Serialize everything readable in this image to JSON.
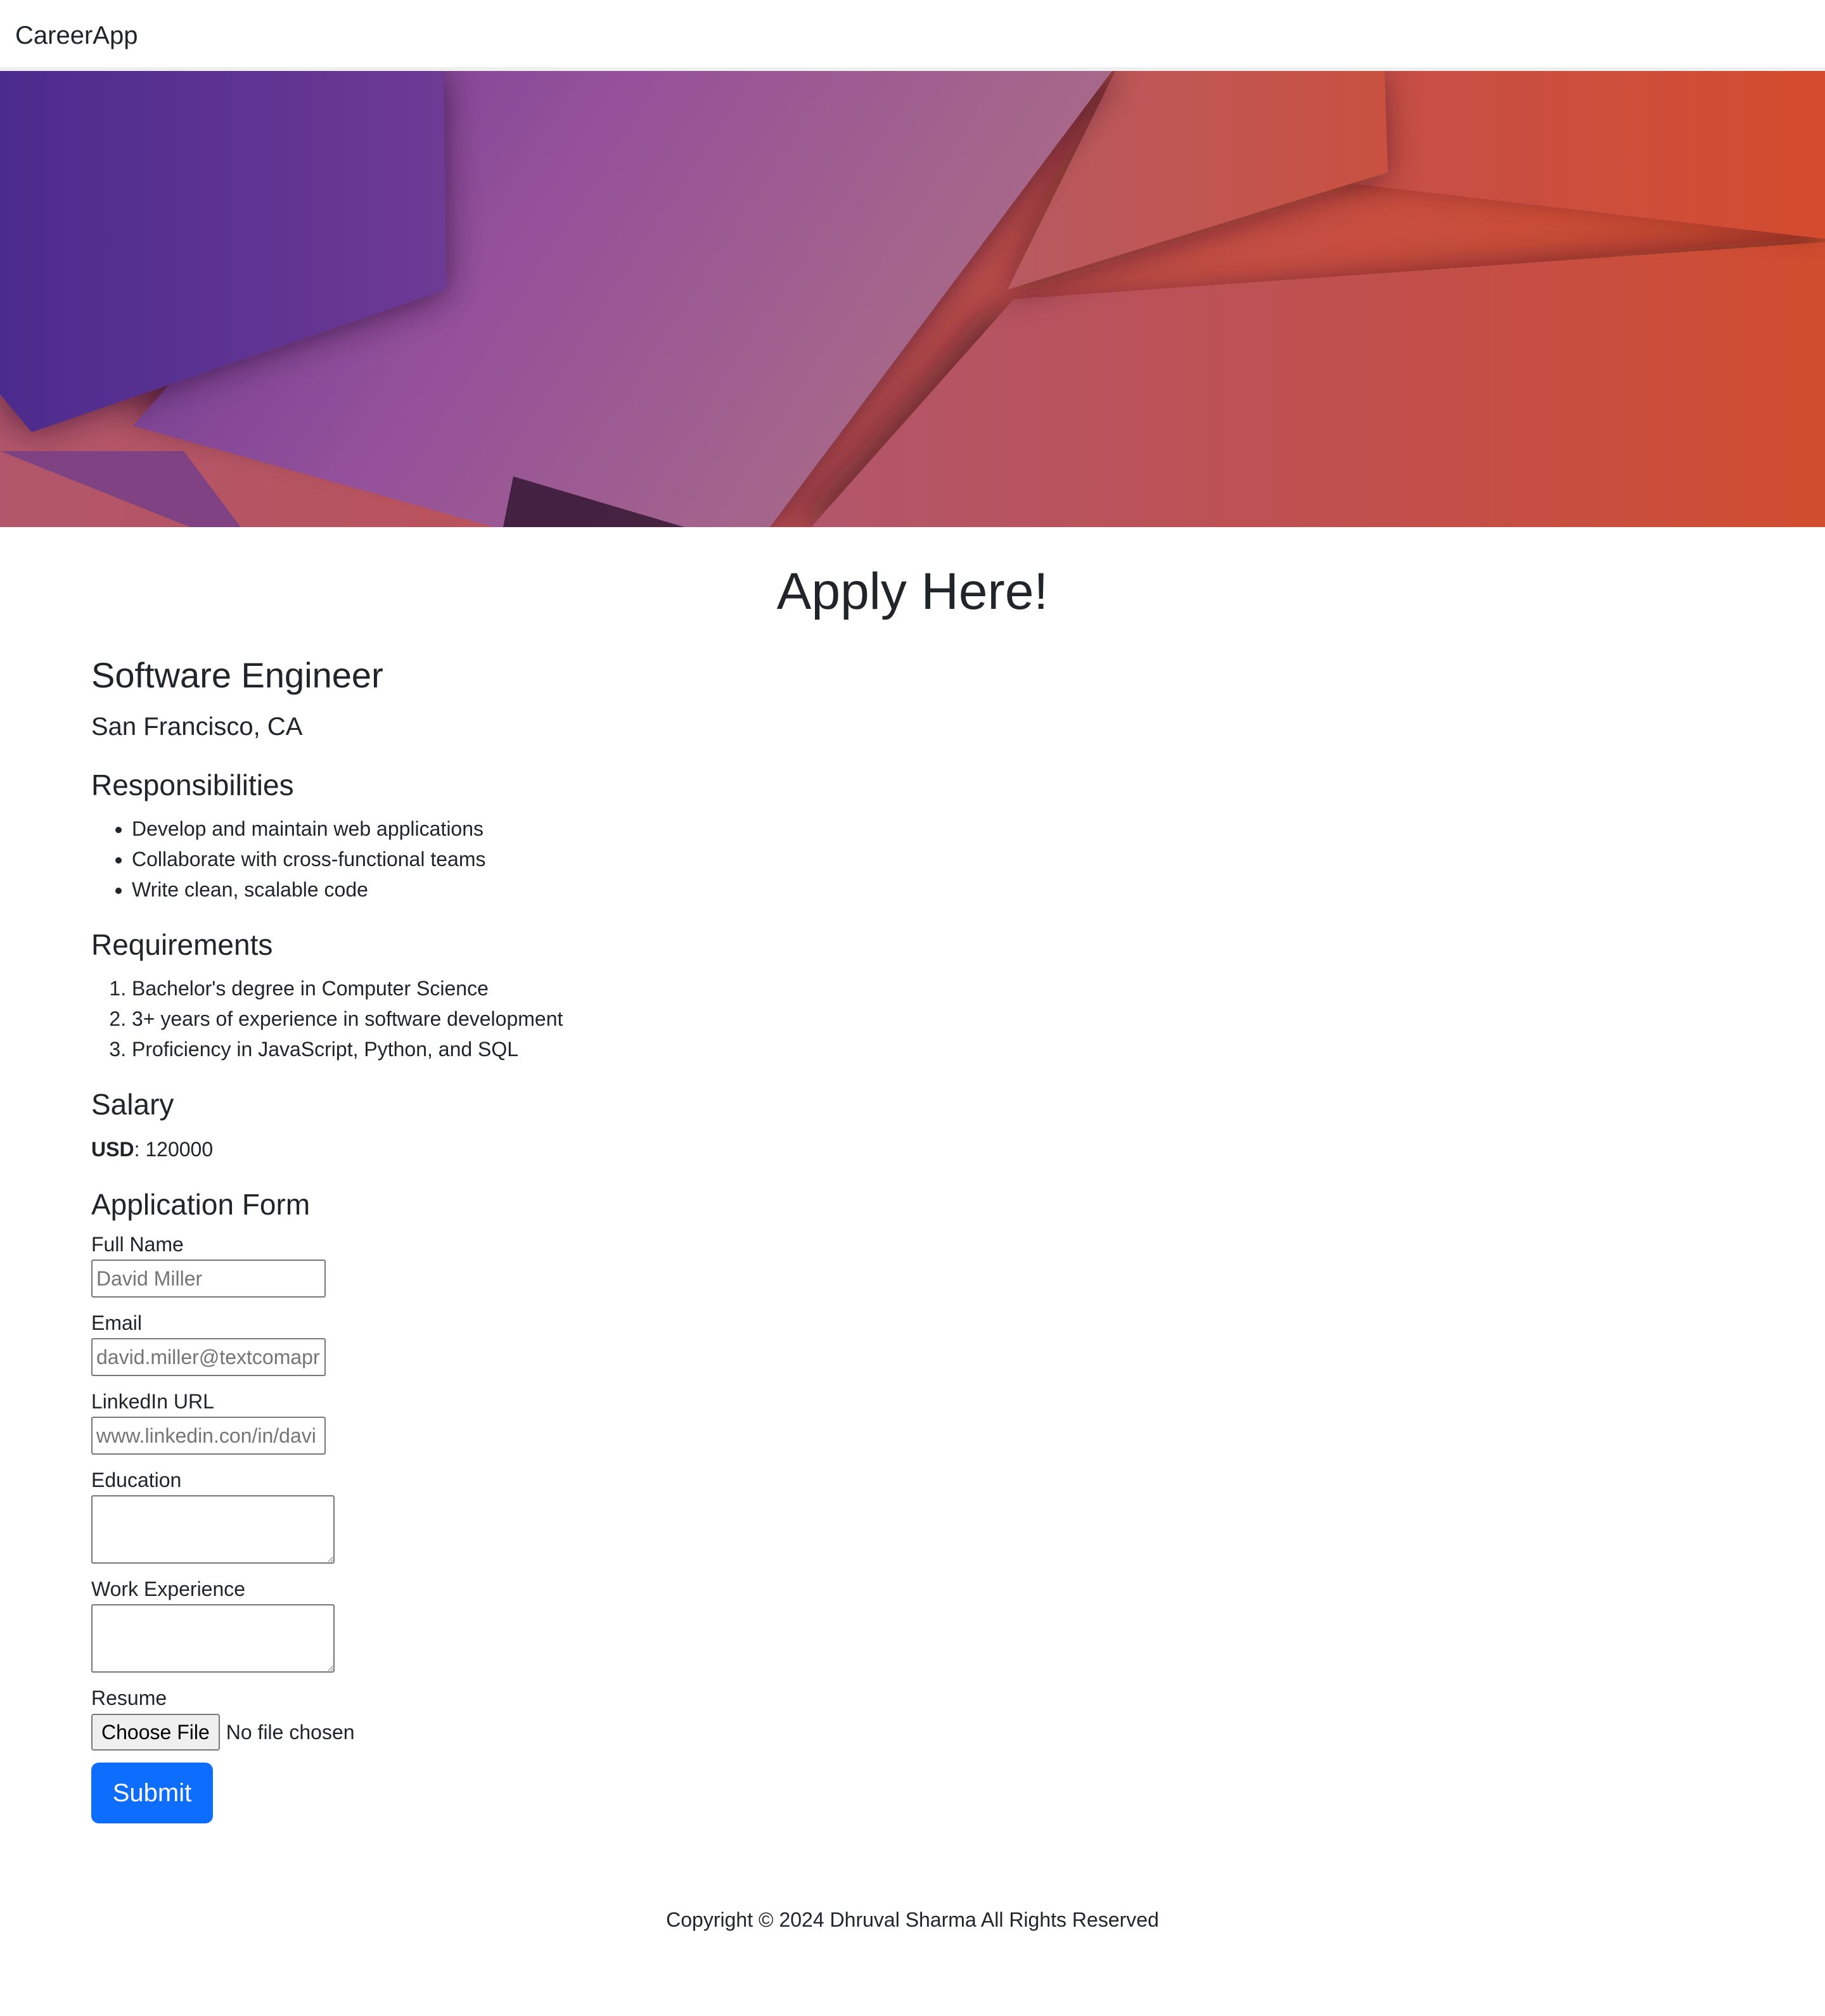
{
  "navbar": {
    "brand": "CareerApp"
  },
  "hero": {
    "image": "abstract-purple-orange-banner"
  },
  "page": {
    "title": "Apply Here!"
  },
  "job": {
    "title": "Software Engineer",
    "location": "San Francisco, CA",
    "responsibilities_heading": "Responsibilities",
    "responsibilities": [
      "Develop and maintain web applications",
      "Collaborate with cross-functional teams",
      "Write clean, scalable code"
    ],
    "requirements_heading": "Requirements",
    "requirements": [
      "Bachelor's degree in Computer Science",
      "3+ years of experience in software development",
      "Proficiency in JavaScript, Python, and SQL"
    ],
    "salary_heading": "Salary",
    "salary_currency": "USD",
    "salary_separator": ": ",
    "salary_amount": "120000"
  },
  "form": {
    "heading": "Application Form",
    "full_name_label": "Full Name",
    "full_name_placeholder": "David Miller",
    "email_label": "Email",
    "email_placeholder": "david.miller@textcomapr",
    "linkedin_label": "LinkedIn URL",
    "linkedin_placeholder": "www.linkedin.con/in/davi",
    "education_label": "Education",
    "work_label": "Work Experience",
    "resume_label": "Resume",
    "file_button": "Choose File",
    "file_status": "No file chosen",
    "submit_label": "Submit"
  },
  "footer": {
    "copyright": "Copyright © 2024 Dhruval Sharma All Rights Reserved"
  },
  "colors": {
    "primary": "#0d6efd",
    "text": "#212529"
  }
}
